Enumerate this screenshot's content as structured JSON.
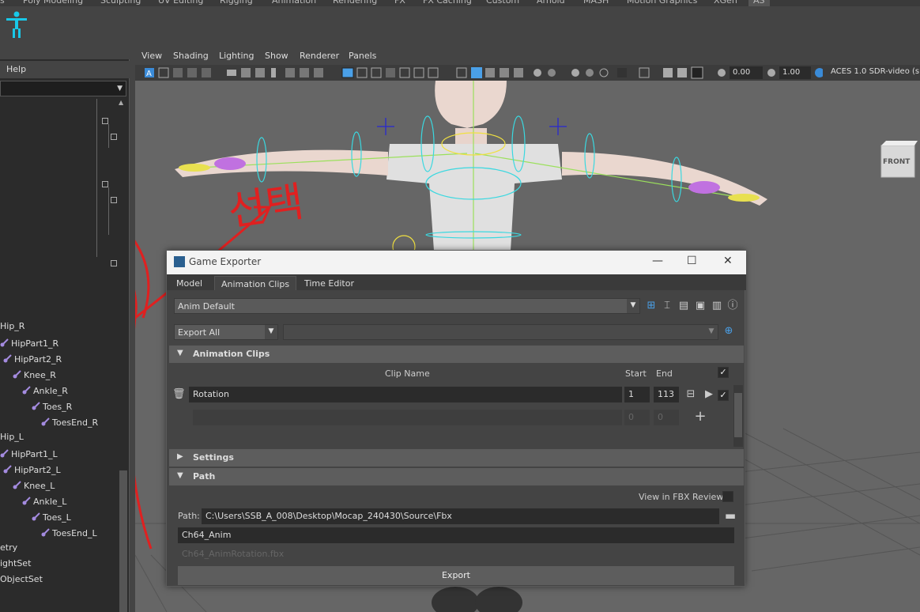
{
  "shelf": {
    "tabs": [
      "s",
      "Poly Modeling",
      "Sculpting",
      "UV Editing",
      "Rigging",
      "Animation",
      "Rendering",
      "FX",
      "FX Caching",
      "Custom",
      "Arnold",
      "MASH",
      "Motion Graphics",
      "XGen",
      "AS"
    ]
  },
  "outliner": {
    "menu_label": "Help",
    "items": [
      {
        "label": "Hip_R"
      },
      {
        "label": "HipPart1_R"
      },
      {
        "label": "HipPart2_R"
      },
      {
        "label": "Knee_R"
      },
      {
        "label": "Ankle_R"
      },
      {
        "label": "Toes_R"
      },
      {
        "label": "ToesEnd_R"
      },
      {
        "label": "Hip_L"
      },
      {
        "label": "HipPart1_L"
      },
      {
        "label": "HipPart2_L"
      },
      {
        "label": "Knee_L"
      },
      {
        "label": "Ankle_L"
      },
      {
        "label": "Toes_L"
      },
      {
        "label": "ToesEnd_L"
      },
      {
        "label": "etry"
      },
      {
        "label": "ightSet"
      },
      {
        "label": "ObjectSet"
      }
    ]
  },
  "viewport": {
    "menu": [
      "View",
      "Shading",
      "Lighting",
      "Show",
      "Renderer",
      "Panels"
    ],
    "value1": "0.00",
    "value2": "1.00",
    "color_space": "ACES 1.0 SDR-video (s",
    "view_cube_label": "FRONT",
    "annotation": "선택"
  },
  "game_exporter": {
    "title": "Game Exporter",
    "tabs": [
      "Model",
      "Animation Clips",
      "Time Editor"
    ],
    "active_tab": "Animation Clips",
    "preset": "Anim Default",
    "export_mode": "Export All",
    "sections": {
      "clips": "Animation Clips",
      "settings": "Settings",
      "path": "Path"
    },
    "columns": {
      "clip_name": "Clip Name",
      "start": "Start",
      "end": "End"
    },
    "clips": [
      {
        "name": "Rotation",
        "start": "1",
        "end": "113"
      }
    ],
    "new_clip": {
      "start": "0",
      "end": "0"
    },
    "view_in_fbx_review": "View in FBX Review",
    "path_label": "Path:",
    "path_value": "C:\\Users\\SSB_A_008\\Desktop\\Mocap_240430\\Source\\Fbx",
    "file_prefix": "Ch64_Anim",
    "file_preview": "Ch64_AnimRotation.fbx",
    "export_button": "Export"
  }
}
